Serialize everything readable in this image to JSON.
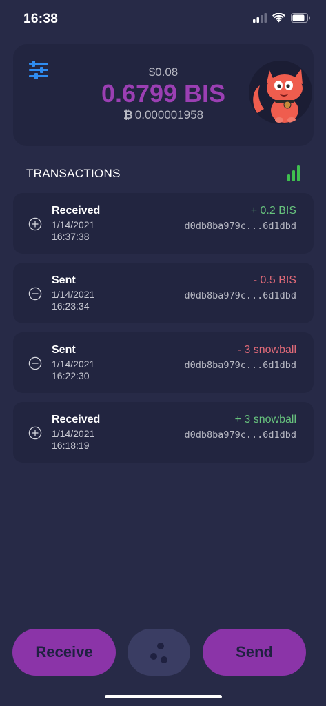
{
  "status_bar": {
    "time": "16:38"
  },
  "header": {
    "fiat_balance": "$0.08",
    "main_balance": "0.6799 BIS",
    "btc_symbol": "₿",
    "btc_balance": "0.000001958"
  },
  "transactions": {
    "title": "TRANSACTIONS",
    "items": [
      {
        "type": "Received",
        "date": "1/14/2021",
        "time": "16:37:38",
        "amount": "+ 0.2 BIS",
        "hash": "d0db8ba979c...6d1dbd"
      },
      {
        "type": "Sent",
        "date": "1/14/2021",
        "time": "16:23:34",
        "amount": "- 0.5 BIS",
        "hash": "d0db8ba979c...6d1dbd"
      },
      {
        "type": "Sent",
        "date": "1/14/2021",
        "time": "16:22:30",
        "amount": "- 3 snowball",
        "hash": "d0db8ba979c...6d1dbd"
      },
      {
        "type": "Received",
        "date": "1/14/2021",
        "time": "16:18:19",
        "amount": "+ 3 snowball",
        "hash": "d0db8ba979c...6d1dbd"
      }
    ]
  },
  "actions": {
    "receive_label": "Receive",
    "send_label": "Send"
  },
  "colors": {
    "background": "#272a47",
    "card": "#222540",
    "accent": "#9b3fb3",
    "positive": "#67c27d",
    "negative": "#e06a78"
  }
}
